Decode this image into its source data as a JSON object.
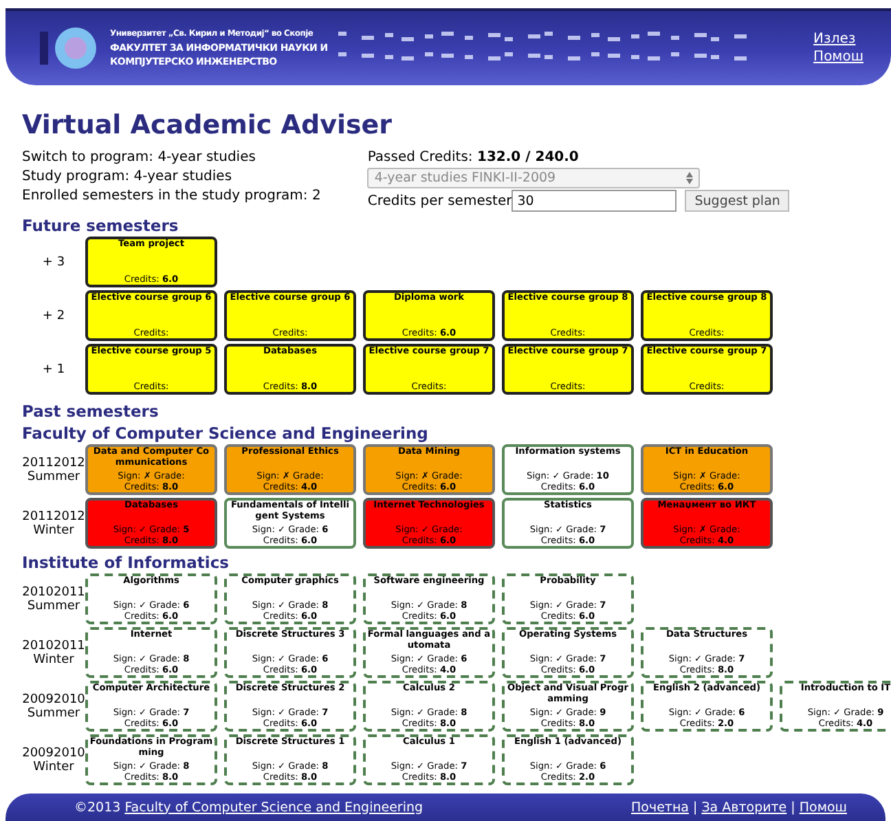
{
  "header": {
    "university": "Универзитет „Св. Кирил и Методиј“ во Скопје",
    "faculty_line_1": "ФАКУЛТЕТ ЗА ИНФОРМАТИЧКИ НАУКИ И",
    "faculty_line_2": "КОМПЈУТЕРСКО ИНЖЕНЕРСТВО",
    "links": [
      "Излез",
      "Помош"
    ]
  },
  "title": "Virtual Academic Adviser",
  "info": {
    "switch": "Switch to program: 4-year studies",
    "program": "Study program: 4-year studies",
    "enrolled": "Enrolled semesters in the study program: 2",
    "passed": "Passed Credits: **132.0 / 240.0**",
    "program_select": "4-year studies FINKI-II-2009",
    "credits_label": "Credits per semester",
    "credits_value": "30",
    "suggest_button": "Suggest plan"
  },
  "sections": [
    {
      "heading": "Future semesters",
      "kind": "section",
      "semesters": [
        {
          "label": "+ 3",
          "courses": [
            {
              "title": "Team project",
              "kind": "planned",
              "credits": "Credits: **6.0**"
            }
          ]
        },
        {
          "label": "+ 2",
          "courses": [
            {
              "title": "Elective course group 6",
              "kind": "planned",
              "credits": "Credits:"
            },
            {
              "title": "Elective course group 6",
              "kind": "planned",
              "credits": "Credits:"
            },
            {
              "title": "Diploma work",
              "kind": "planned",
              "credits": "Credits: **6.0**"
            },
            {
              "title": "Elective course group 8",
              "kind": "planned",
              "credits": "Credits:"
            },
            {
              "title": "Elective course group 8",
              "kind": "planned",
              "credits": "Credits:"
            }
          ]
        },
        {
          "label": "+ 1",
          "courses": [
            {
              "title": "Elective course group 5",
              "kind": "planned",
              "credits": "Credits:"
            },
            {
              "title": "Databases",
              "kind": "planned",
              "credits": "Credits: **8.0**"
            },
            {
              "title": "Elective course group 7",
              "kind": "planned",
              "credits": "Credits:"
            },
            {
              "title": "Elective course group 7",
              "kind": "planned",
              "credits": "Credits:"
            },
            {
              "title": "Elective course group 7",
              "kind": "planned",
              "credits": "Credits:"
            }
          ]
        }
      ]
    },
    {
      "heading": "Past semesters",
      "kind": "section"
    },
    {
      "heading": "Faculty of Computer Science and Engineering",
      "kind": "subsection",
      "semesters": [
        {
          "label": "20112012",
          "season": "Summer",
          "courses": [
            {
              "title": "Data and Computer Communications",
              "kind": "unsigned",
              "grade": "Sign: ✗ Grade:",
              "credits": "Credits: **8.0**"
            },
            {
              "title": "Professional Ethics",
              "kind": "unsigned",
              "grade": "Sign: ✗ Grade:",
              "credits": "Credits: **4.0**"
            },
            {
              "title": "Data Mining",
              "kind": "unsigned",
              "grade": "Sign: ✗ Grade:",
              "credits": "Credits: **6.0**"
            },
            {
              "title": "Information systems",
              "kind": "passed",
              "grade": "Sign: ✓ Grade: **10**",
              "credits": "Credits: **6.0**"
            },
            {
              "title": "ICT in Education",
              "kind": "unsigned",
              "grade": "Sign: ✗ Grade:",
              "credits": "Credits: **6.0**"
            }
          ]
        },
        {
          "label": "20112012",
          "season": "Winter",
          "courses": [
            {
              "title": "Databases",
              "kind": "failed",
              "grade": "Sign: ✓ Grade: **5**",
              "credits": "Credits: **8.0**"
            },
            {
              "title": "Fundamentals of Intelligent Systems",
              "kind": "passed",
              "grade": "Sign: ✓ Grade: **6**",
              "credits": "Credits: **6.0**"
            },
            {
              "title": "Internet Technologies",
              "kind": "failed",
              "grade": "Sign: ✓ Grade:",
              "credits": "Credits: **6.0**"
            },
            {
              "title": "Statistics",
              "kind": "passed",
              "grade": "Sign: ✓ Grade: **7**",
              "credits": "Credits: **6.0**"
            },
            {
              "title": "Менаџмент во ИКТ",
              "kind": "failed",
              "grade": "Sign: ✗ Grade:",
              "credits": "Credits: **4.0**"
            }
          ]
        }
      ]
    },
    {
      "heading": "Institute of Informatics",
      "kind": "subsection",
      "semesters": [
        {
          "label": "20102011",
          "season": "Summer",
          "courses": [
            {
              "title": "Algorithms",
              "kind": "transferred",
              "grade": "Sign: ✓ Grade: **6**",
              "credits": "Credits: **6.0**"
            },
            {
              "title": "Computer graphics",
              "kind": "transferred",
              "grade": "Sign: ✓ Grade: **8**",
              "credits": "Credits: **6.0**"
            },
            {
              "title": "Software engineering",
              "kind": "transferred",
              "grade": "Sign: ✓ Grade: **8**",
              "credits": "Credits: **6.0**"
            },
            {
              "title": "Probability",
              "kind": "transferred",
              "grade": "Sign: ✓ Grade: **7**",
              "credits": "Credits: **6.0**"
            }
          ]
        },
        {
          "label": "20102011",
          "season": "Winter",
          "courses": [
            {
              "title": "Internet",
              "kind": "transferred",
              "grade": "Sign: ✓ Grade: **8**",
              "credits": "Credits: **6.0**"
            },
            {
              "title": "Discrete Structures 3",
              "kind": "transferred",
              "grade": "Sign: ✓ Grade: **6**",
              "credits": "Credits: **6.0**"
            },
            {
              "title": "Formal languages and automata",
              "kind": "transferred",
              "grade": "Sign: ✓ Grade: **6**",
              "credits": "Credits: **4.0**"
            },
            {
              "title": "Operating Systems",
              "kind": "transferred",
              "grade": "Sign: ✓ Grade: **7**",
              "credits": "Credits: **6.0**"
            },
            {
              "title": "Data Structures",
              "kind": "transferred",
              "grade": "Sign: ✓ Grade: **7**",
              "credits": "Credits: **8.0**"
            }
          ]
        },
        {
          "label": "20092010",
          "season": "Summer",
          "courses": [
            {
              "title": "Computer Architecture",
              "kind": "transferred",
              "grade": "Sign: ✓ Grade: **7**",
              "credits": "Credits: **6.0**"
            },
            {
              "title": "Discrete Structures 2",
              "kind": "transferred",
              "grade": "Sign: ✓ Grade: **7**",
              "credits": "Credits: **6.0**"
            },
            {
              "title": "Calculus 2",
              "kind": "transferred",
              "grade": "Sign: ✓ Grade: **8**",
              "credits": "Credits: **8.0**"
            },
            {
              "title": "Object and Visual Programming",
              "kind": "transferred",
              "grade": "Sign: ✓ Grade: **9**",
              "credits": "Credits: **8.0**"
            },
            {
              "title": "English 2 (advanced)",
              "kind": "transferred",
              "grade": "Sign: ✓ Grade: **6**",
              "credits": "Credits: **2.0**"
            },
            {
              "title": "Introduction to IT",
              "kind": "transferred",
              "grade": "Sign: ✓ Grade: **9**",
              "credits": "Credits: **4.0**"
            }
          ]
        },
        {
          "label": "20092010",
          "season": "Winter",
          "courses": [
            {
              "title": "Foundations in Programming",
              "kind": "transferred",
              "grade": "Sign: ✓ Grade: **8**",
              "credits": "Credits: **8.0**"
            },
            {
              "title": "Discrete Structures 1",
              "kind": "transferred",
              "grade": "Sign: ✓ Grade: **8**",
              "credits": "Credits: **8.0**"
            },
            {
              "title": "Calculus 1",
              "kind": "transferred",
              "grade": "Sign: ✓ Grade: **7**",
              "credits": "Credits: **8.0**"
            },
            {
              "title": "English 1 (advanced)",
              "kind": "transferred",
              "grade": "Sign: ✓ Grade: **6**",
              "credits": "Credits: **2.0**"
            }
          ]
        }
      ]
    }
  ],
  "footer": {
    "copyright": "©2013",
    "faculty_link": "Faculty of Computer Science and Engineering",
    "links": [
      "Почетна",
      "За Авторите",
      "Помош"
    ],
    "separators": [
      "|",
      "|"
    ]
  }
}
